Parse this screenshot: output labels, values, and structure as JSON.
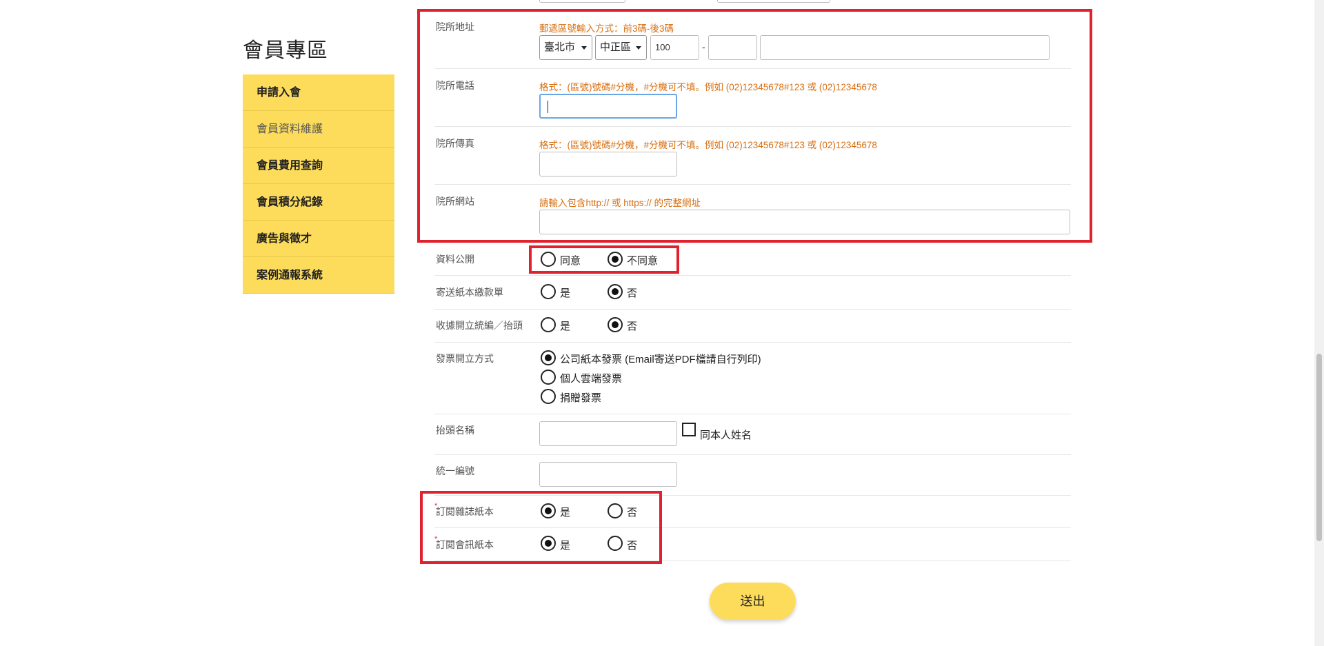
{
  "sidebar": {
    "title": "會員專區",
    "items": [
      {
        "label": "申請入會"
      },
      {
        "label": "會員資料維護"
      },
      {
        "label": "會員費用查詢"
      },
      {
        "label": "會員積分紀錄"
      },
      {
        "label": "廣告與徵才"
      },
      {
        "label": "案例通報系統"
      }
    ]
  },
  "form": {
    "address": {
      "label": "院所地址",
      "hint": "郵遞區號輸入方式：前3碼-後3碼",
      "city": "臺北市",
      "district": "中正區",
      "zip_prefix": "100",
      "zip_sep": "-",
      "zip_suffix": "",
      "street": ""
    },
    "phone": {
      "label": "院所電話",
      "hint": "格式：(區號)號碼#分機，#分機可不填。例如 (02)12345678#123 或 (02)12345678",
      "value": ""
    },
    "fax": {
      "label": "院所傳真",
      "hint": "格式：(區號)號碼#分機，#分機可不填。例如 (02)12345678#123 或 (02)12345678",
      "value": ""
    },
    "website": {
      "label": "院所網站",
      "hint": "請輸入包含http:// 或 https:// 的完整網址",
      "value": ""
    },
    "public_data": {
      "label": "資料公開",
      "options": [
        "同意",
        "不同意"
      ],
      "selected": "不同意"
    },
    "paper_bill": {
      "label": "寄送紙本繳款單",
      "options": [
        "是",
        "否"
      ],
      "selected": "否"
    },
    "receipt_taxid": {
      "label": "收據開立統編／抬頭",
      "options": [
        "是",
        "否"
      ],
      "selected": "否"
    },
    "invoice": {
      "label": "發票開立方式",
      "options": [
        "公司紙本發票 (Email寄送PDF檔請自行列印)",
        "個人雲端發票",
        "捐贈發票"
      ],
      "selected": "公司紙本發票 (Email寄送PDF檔請自行列印)"
    },
    "title_name": {
      "label": "抬頭名稱",
      "value": "",
      "checkbox_label": "同本人姓名",
      "checked": false
    },
    "tax_id": {
      "label": "統一編號",
      "value": ""
    },
    "magazine": {
      "required_mark": "*",
      "label": "訂閱雜誌紙本",
      "options": [
        "是",
        "否"
      ],
      "selected": "是"
    },
    "newsletter": {
      "required_mark": "*",
      "label": "訂閱會訊紙本",
      "options": [
        "是",
        "否"
      ],
      "selected": "是"
    },
    "submit_label": "送出"
  }
}
